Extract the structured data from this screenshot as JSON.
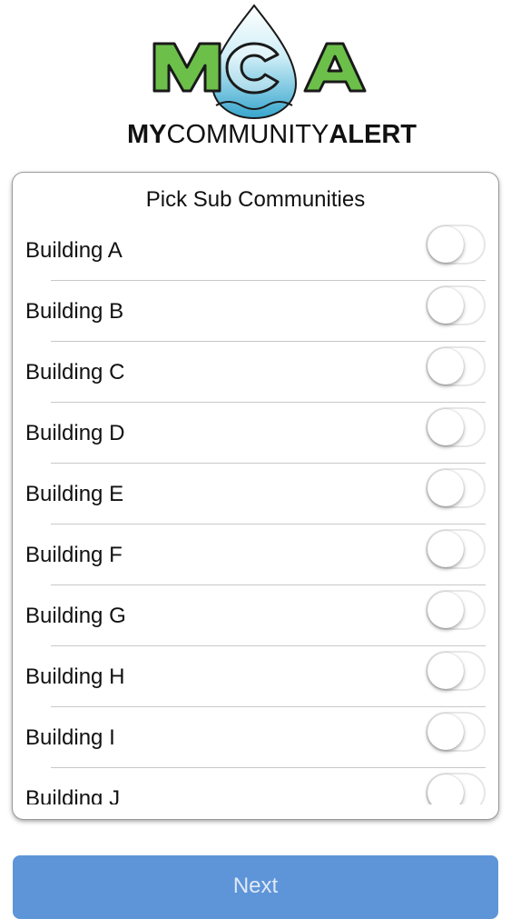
{
  "logo": {
    "letters": "MCA",
    "brand_bold_1": "MY",
    "brand_light": "COMMUNITY",
    "brand_bold_2": "ALERT"
  },
  "card": {
    "title": "Pick Sub Communities",
    "items": [
      {
        "label": "Building A",
        "on": false
      },
      {
        "label": "Building B",
        "on": false
      },
      {
        "label": "Building C",
        "on": false
      },
      {
        "label": "Building D",
        "on": false
      },
      {
        "label": "Building E",
        "on": false
      },
      {
        "label": "Building F",
        "on": false
      },
      {
        "label": "Building G",
        "on": false
      },
      {
        "label": "Building H",
        "on": false
      },
      {
        "label": "Building I",
        "on": false
      },
      {
        "label": "Building J",
        "on": false
      }
    ]
  },
  "footer": {
    "next_label": "Next"
  },
  "colors": {
    "accent": "#5e95d9",
    "logo_green": "#6cc04a",
    "logo_drop": "#3aa7c9"
  }
}
